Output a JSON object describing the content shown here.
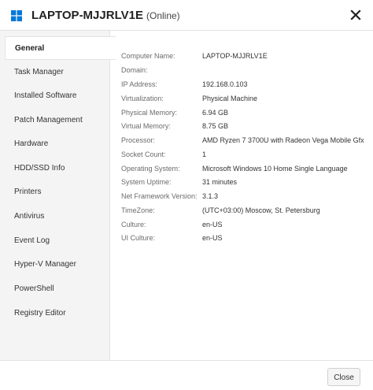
{
  "window": {
    "title": "LAPTOP-MJJRLV1E",
    "status": "(Online)",
    "icon": "windows-logo",
    "close_icon": "close-icon"
  },
  "sidebar": {
    "items": [
      {
        "label": "General",
        "active": true
      },
      {
        "label": "Task Manager"
      },
      {
        "label": "Installed Software"
      },
      {
        "label": "Patch Management"
      },
      {
        "label": "Hardware"
      },
      {
        "label": "HDD/SSD Info"
      },
      {
        "label": "Printers"
      },
      {
        "label": "Antivirus"
      },
      {
        "label": "Event Log"
      },
      {
        "label": "Hyper-V Manager"
      },
      {
        "label": "PowerShell"
      },
      {
        "label": "Registry Editor"
      }
    ]
  },
  "general": {
    "rows": [
      {
        "key": "Computer Name:",
        "value": "LAPTOP-MJJRLV1E"
      },
      {
        "key": "Domain:",
        "value": ""
      },
      {
        "key": "IP Address:",
        "value": "192.168.0.103"
      },
      {
        "key": "Virtualization:",
        "value": "Physical Machine"
      },
      {
        "key": "Physical Memory:",
        "value": "6.94 GB"
      },
      {
        "key": "Virtual Memory:",
        "value": "8.75 GB"
      },
      {
        "key": "Processor:",
        "value": "AMD Ryzen 7 3700U with Radeon Vega Mobile Gfx"
      },
      {
        "key": "Socket Count:",
        "value": "1"
      },
      {
        "key": "Operating System:",
        "value": "Microsoft Windows 10 Home Single Language"
      },
      {
        "key": "System Uptime:",
        "value": "31 minutes"
      },
      {
        "key": "Net Framework Version:",
        "value": "3.1.3"
      },
      {
        "key": "TimeZone:",
        "value": "(UTC+03:00) Moscow, St. Petersburg"
      },
      {
        "key": "Culture:",
        "value": "en-US"
      },
      {
        "key": "UI Culture:",
        "value": "en-US"
      }
    ]
  },
  "footer": {
    "close_label": "Close"
  },
  "colors": {
    "windows_blue": "#0078d7",
    "sidebar_bg": "#f4f4f4",
    "border": "#e3e3e3"
  }
}
